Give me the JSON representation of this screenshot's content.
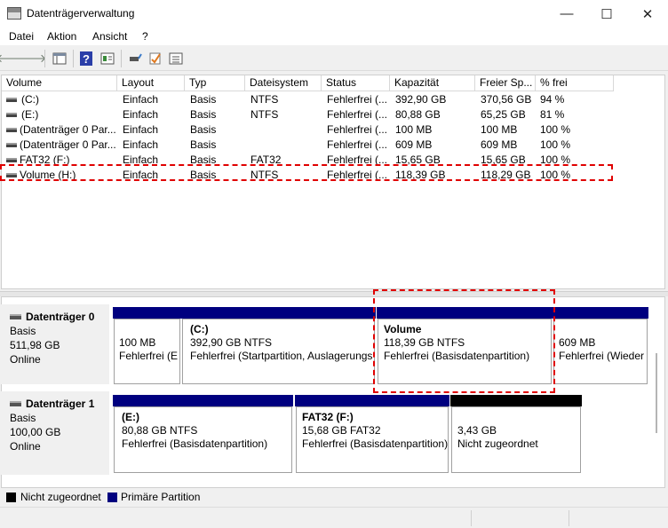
{
  "window": {
    "title": "Datenträgerverwaltung",
    "minimize": "—",
    "maximize": "☐",
    "close": "✕"
  },
  "menu": [
    {
      "label": "Datei"
    },
    {
      "label": "Aktion"
    },
    {
      "label": "Ansicht"
    },
    {
      "label": "?"
    }
  ],
  "toolbar": {
    "back": "🡐",
    "forward": "🡒",
    "help": "?"
  },
  "columns": [
    "Volume",
    "Layout",
    "Typ",
    "Dateisystem",
    "Status",
    "Kapazität",
    "Freier Sp...",
    "% frei"
  ],
  "volumes": [
    [
      "(C:)",
      "Einfach",
      "Basis",
      "NTFS",
      "Fehlerfrei (...",
      "392,90 GB",
      "370,56 GB",
      "94 %"
    ],
    [
      "(E:)",
      "Einfach",
      "Basis",
      "NTFS",
      "Fehlerfrei (...",
      "80,88 GB",
      "65,25 GB",
      "81 %"
    ],
    [
      "(Datenträger 0 Par...",
      "Einfach",
      "Basis",
      "",
      "Fehlerfrei (...",
      "100 MB",
      "100 MB",
      "100 %"
    ],
    [
      "(Datenträger 0 Par...",
      "Einfach",
      "Basis",
      "",
      "Fehlerfrei (...",
      "609 MB",
      "609 MB",
      "100 %"
    ],
    [
      "FAT32 (F:)",
      "Einfach",
      "Basis",
      "FAT32",
      "Fehlerfrei (...",
      "15,65 GB",
      "15,65 GB",
      "100 %"
    ],
    [
      "Volume (H:)",
      "Einfach",
      "Basis",
      "NTFS",
      "Fehlerfrei (...",
      "118,39 GB",
      "118,29 GB",
      "100 %"
    ]
  ],
  "disks": [
    {
      "name": "Datenträger 0",
      "type": "Basis",
      "size": "511,98 GB",
      "status": "Online",
      "partitions": [
        {
          "name": "",
          "size": "100 MB",
          "status": "Fehlerfrei (E"
        },
        {
          "name": "(C:)",
          "size": "392,90 GB NTFS",
          "status": "Fehlerfrei (Startpartition, Auslagerungs"
        },
        {
          "name": "Volume",
          "size": "118,39 GB NTFS",
          "status": "Fehlerfrei (Basisdatenpartition)"
        },
        {
          "name": "",
          "size": "609 MB",
          "status": "Fehlerfrei (Wieder"
        }
      ]
    },
    {
      "name": "Datenträger 1",
      "type": "Basis",
      "size": "100,00 GB",
      "status": "Online",
      "partitions": [
        {
          "name": "(E:)",
          "size": "80,88 GB NTFS",
          "status": "Fehlerfrei (Basisdatenpartition)"
        },
        {
          "name": "FAT32  (F:)",
          "size": "15,68 GB FAT32",
          "status": "Fehlerfrei (Basisdatenpartition)"
        },
        {
          "name": "",
          "size": "3,43 GB",
          "status": "Nicht zugeordnet"
        }
      ]
    }
  ],
  "legend": [
    {
      "label": "Nicht zugeordnet",
      "color": "#000000"
    },
    {
      "label": "Primäre Partition",
      "color": "#00007f"
    }
  ]
}
